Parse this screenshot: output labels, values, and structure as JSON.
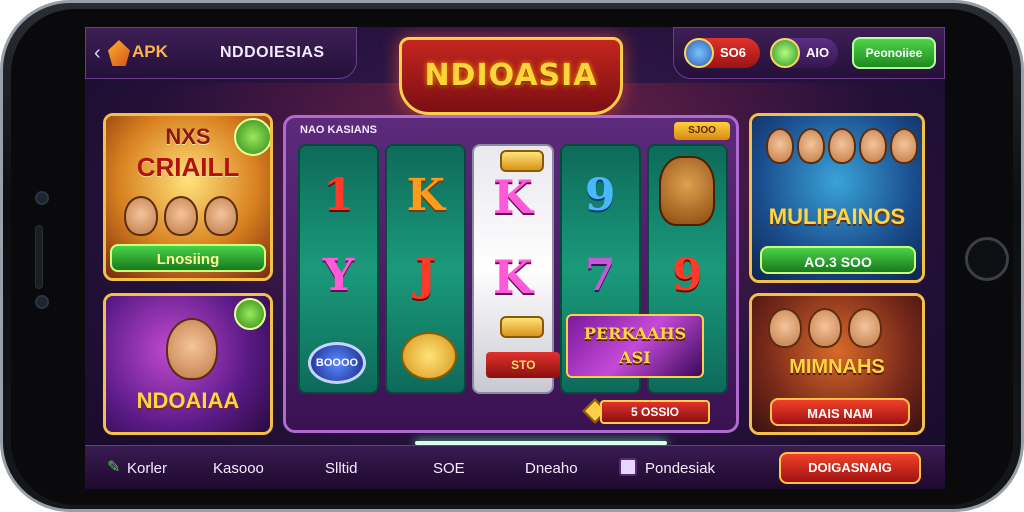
{
  "topbar": {
    "back_icon": "chevron-left-icon",
    "apk_label": "APK",
    "title": "NDDOIESIAS",
    "logo_text": "NDIOASIA",
    "balance_red": "SO6",
    "balance_purple": "AIO",
    "promo_button": "Peonoiiee"
  },
  "cards": {
    "top_left": {
      "title_1": "NXS",
      "title_2": "CRIAILL",
      "button": "Lnosiing"
    },
    "bottom_left": {
      "title": "NDOAIAA"
    },
    "top_right": {
      "title": "MULIPAINOS",
      "button": "AO.3 SOO"
    },
    "bottom_right": {
      "title": "MIMNAHS",
      "button": "MAIS NAM"
    }
  },
  "slot": {
    "label": "NAO KASIANS",
    "win_badge": "SJOO",
    "reel1": [
      "1",
      "Y",
      "BOOOO"
    ],
    "reel2": [
      "K",
      "J"
    ],
    "reel3": [
      "K",
      "K",
      "STO"
    ],
    "reel4": [
      "9",
      "7"
    ],
    "reel5": [
      "9"
    ],
    "bonus_text": "PERKAAHS ASI",
    "footer_value": "5 OSSIO"
  },
  "nav": {
    "item1": "Korler",
    "item2": "Kasooo",
    "item3": "Slltid",
    "item4": "SOE",
    "item5": "Dneaho",
    "item6": "Pondesiak",
    "cta": "DOIGASNAIG"
  },
  "colors": {
    "accent_gold": "#ffd640",
    "accent_red": "#e0322c",
    "accent_green": "#49d24a",
    "background_purple": "#2a1442"
  }
}
